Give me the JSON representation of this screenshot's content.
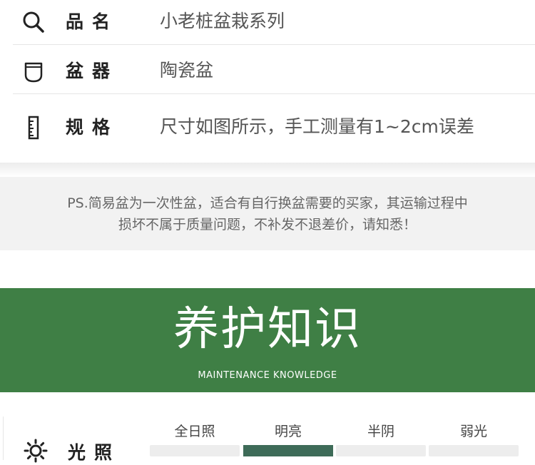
{
  "specs": [
    {
      "icon": "search-icon",
      "label": "品名",
      "value": "小老桩盆栽系列"
    },
    {
      "icon": "pot-icon",
      "label": "盆器",
      "value": "陶瓷盆"
    },
    {
      "icon": "ruler-icon",
      "label": "规格",
      "value": "尺寸如图所示，手工测量有1~2cm误差"
    }
  ],
  "notice": {
    "line1": "PS.简易盆为一次性盆，适合有自行换盆需要的买家，其运输过程中",
    "line2": "损坏不属于质量问题，不补发不退差价，请知悉！"
  },
  "banner": {
    "title": "养护知识",
    "subtitle": "MAINTENANCE KNOWLEDGE",
    "color": "#3f7f45"
  },
  "lighting": {
    "icon": "sun-icon",
    "label": "光照",
    "levels": [
      "全日照",
      "明亮",
      "半阴",
      "弱光"
    ],
    "selected": "明亮",
    "active_color": "#3e6b58"
  }
}
